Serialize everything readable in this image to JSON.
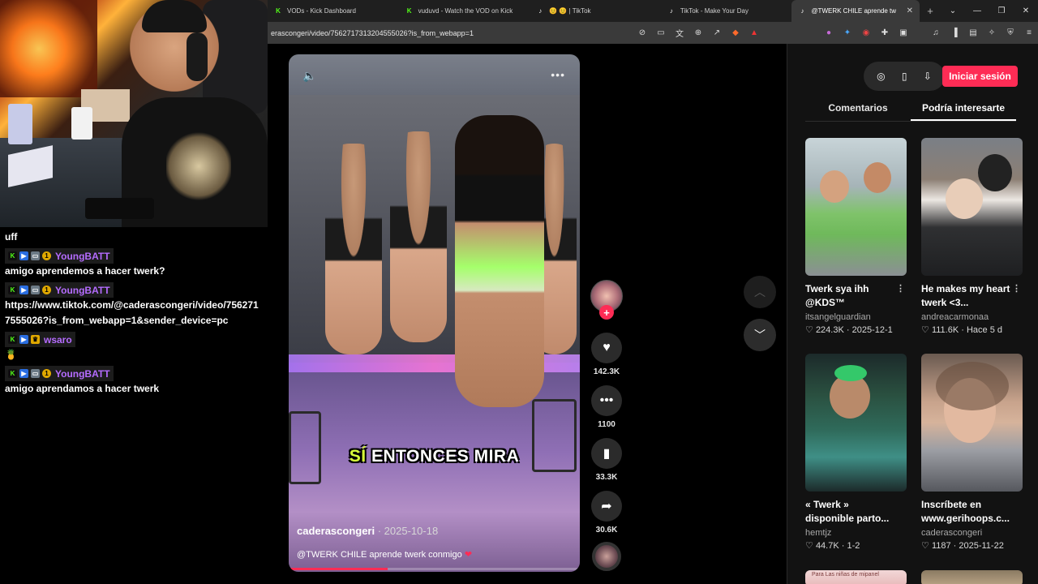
{
  "browser": {
    "tabs": [
      {
        "label": "VODs - Kick Dashboard",
        "icon": "kick-icon"
      },
      {
        "label": "vuduvd - Watch the VOD on Kick",
        "icon": "kick-icon"
      },
      {
        "label": "😊 😊 | TikTok",
        "icon": "tiktok-icon"
      },
      {
        "label": "TikTok - Make Your Day",
        "icon": "tiktok-icon"
      },
      {
        "label": "@TWERK CHILE aprende tw",
        "icon": "tiktok-icon",
        "active": true
      }
    ],
    "url": "erascongeri/video/7562717313204555026?is_from_webapp=1"
  },
  "chat": {
    "messages": [
      {
        "text": "uff"
      },
      {
        "user": "YoungBATT",
        "text": "amigo aprendemos a hacer twerk?"
      },
      {
        "user": "YoungBATT",
        "text": "https://www.tiktok.com/@caderascongeri/video/7562717555026?is_from_webapp=1&sender_device=pc"
      },
      {
        "user": "wsaro",
        "text": "🍍"
      },
      {
        "user": "YoungBATT",
        "text": "amigo aprendamos a hacer twerk"
      }
    ]
  },
  "video": {
    "caption_highlight": "SÍ",
    "caption_rest": "ENTONCES MIRA",
    "author": "caderascongeri",
    "date": "· 2025-10-18",
    "description": "@TWERK CHILE aprende twerk conmigo",
    "progress": 0.34
  },
  "actions": {
    "likes": "142.3K",
    "comments": "1100",
    "saves": "33.3K",
    "shares": "30.6K"
  },
  "panel": {
    "login": "Iniciar sesión",
    "tab_comments": "Comentarios",
    "tab_suggested": "Podría interesarte",
    "cards": [
      {
        "title": "Twerk sya ihh @KDS™",
        "user": "itsangelguardian",
        "likes": "224.3K",
        "date": "2025-12-1"
      },
      {
        "title": "He makes my heart twerk <3...",
        "user": "andreacarmonaa",
        "likes": "111.6K",
        "date": "Hace 5 d"
      },
      {
        "title": "« Twerk » disponible parto...",
        "user": "hemtjz",
        "likes": "44.7K",
        "date": "1-2"
      },
      {
        "title": "Inscríbete en www.gerihoops.c...",
        "user": "caderascongeri",
        "likes": "1187",
        "date": "2025-11-22"
      }
    ],
    "partial_thumb_text": "Para Las niñas de mipanel"
  },
  "colors": {
    "accent": "#fe2c55",
    "chat_user": "#b56cff",
    "kick": "#53fc18"
  }
}
